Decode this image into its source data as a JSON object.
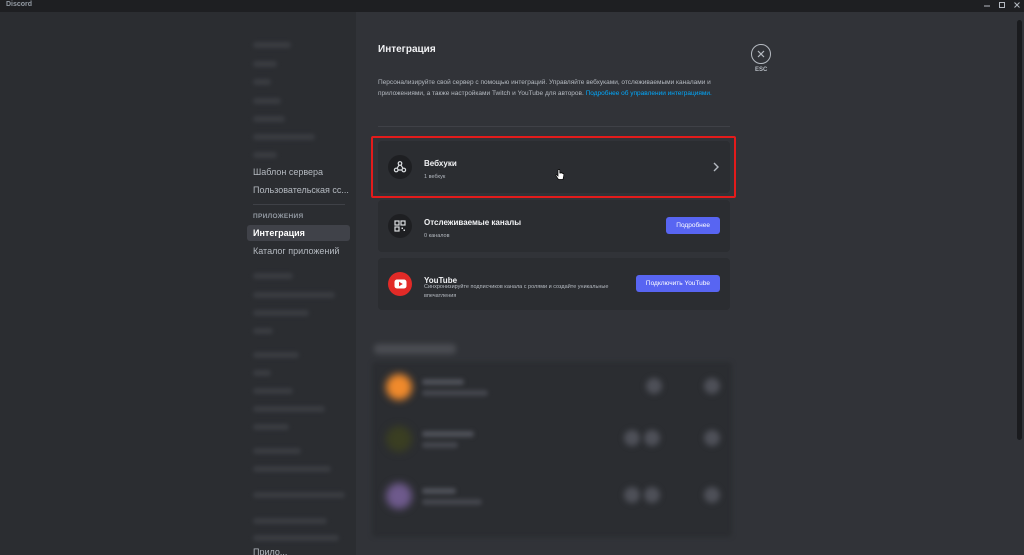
{
  "window": {
    "title": "Discord"
  },
  "sidebar": {
    "items_above": [
      "Шаблон сервера",
      "Пользовательская сс..."
    ],
    "apps_header": "ПРИЛОЖЕНИЯ",
    "apps_items": [
      "Интеграция",
      "Каталог приложений"
    ],
    "bottom_cut": "Прило..."
  },
  "content": {
    "title": "Интеграция",
    "description": "Персонализируйте свой сервер с помощью интеграций. Управляйте вебхуками, отслеживаемыми каналами и приложениями, а также настройками Twitch и YouTube для авторов.",
    "description_link": "Подробнее об управлении интеграциями.",
    "cards": [
      {
        "title": "Вебхуки",
        "subtitle": "1 вебхук",
        "icon": "webhook-icon"
      },
      {
        "title": "Отслеживаемые каналы",
        "subtitle": "0 каналов",
        "button": "Подробнее",
        "icon": "qr-channel-icon"
      },
      {
        "title": "YouTube",
        "subtitle": "Синхронизируйте подписчиков канала с ролями и создайте уникальные впечатления",
        "button": "Подключить YouTube",
        "icon": "youtube-icon"
      }
    ]
  },
  "close": {
    "label": "ESC"
  },
  "colors": {
    "accent": "#5865f2",
    "highlight": "#e31b1b",
    "youtube": "#ff0000",
    "link": "#00a8fc"
  }
}
